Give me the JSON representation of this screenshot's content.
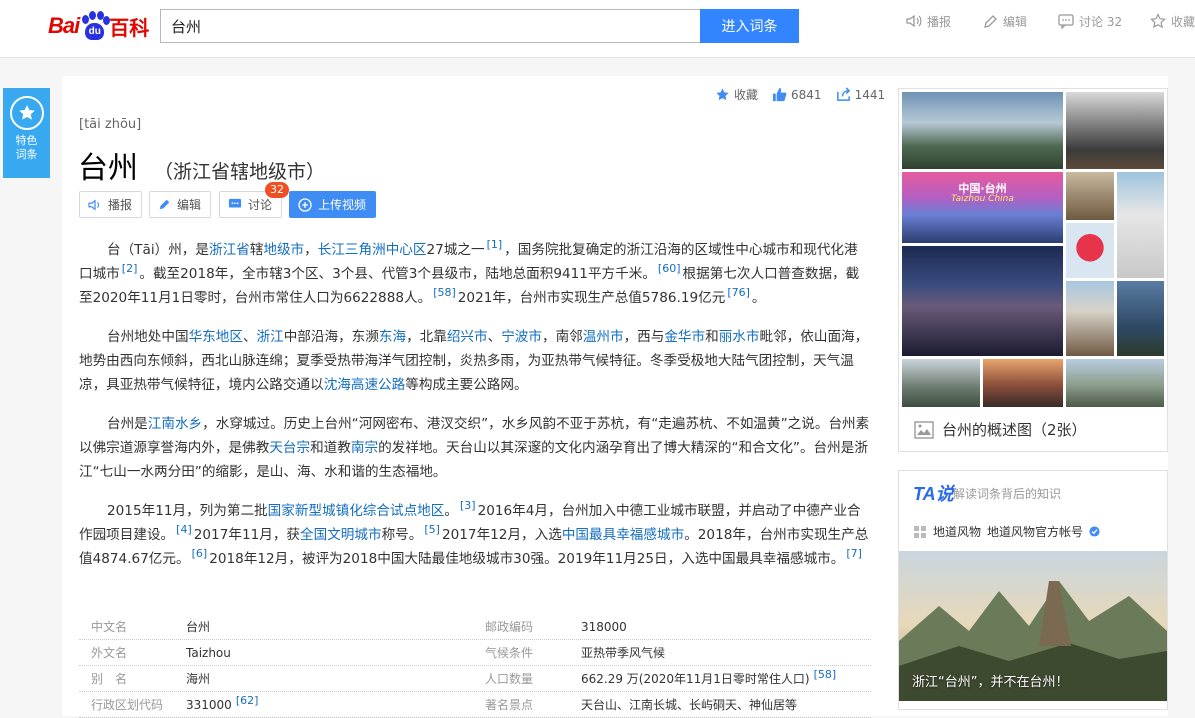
{
  "header": {
    "logo_bai": "Bai",
    "logo_du": "du",
    "logo_baike": "百科",
    "search_value": "台州",
    "search_button": "进入词条",
    "tools": [
      {
        "label": "播报",
        "icon": "speaker-icon"
      },
      {
        "label": "编辑",
        "icon": "pencil-icon"
      },
      {
        "label": "讨论 32",
        "icon": "chat-icon"
      },
      {
        "label": "收藏",
        "icon": "star-icon"
      }
    ]
  },
  "side_tab": {
    "line1": "特色",
    "line2": "词条"
  },
  "stats": {
    "favorite": "收藏",
    "likes": "6841",
    "shares": "1441"
  },
  "entry": {
    "pinyin": "[tāi zhōu]",
    "title": "台州",
    "subtitle": "（浙江省辖地级市）",
    "actions": {
      "broadcast": "播报",
      "edit": "编辑",
      "discuss": "讨论",
      "discuss_count": "32",
      "upload_video": "上传视频"
    }
  },
  "paragraphs": {
    "p1": {
      "t1": "台（Tāi）州，是",
      "l1": "浙江省",
      "t2": "辖",
      "l2": "地级市",
      "t3": "，",
      "l3": "长江三角洲中心区",
      "t4": "27城之一",
      "r1": "[1]",
      "t5": "，国务院批复确定的浙江沿海的区域性中心城市和现代化港口城市",
      "r2": "[2]",
      "t6": "。截至2018年，全市辖3个区、3个县、代管3个县级市，陆地总面积9411平方千米。",
      "r3": "[60]",
      "t7": "根据第七次人口普查数据，截至2020年11月1日零时，台州市常住人口为6622888人。",
      "r4": "[58]",
      "t8": "2021年，台州市实现生产总值5786.19亿元",
      "r5": "[76]",
      "t9": "。"
    },
    "p2": {
      "t1": "台州地处中国",
      "l1": "华东地区",
      "t2": "、",
      "l2": "浙江",
      "t3": "中部沿海，东濒",
      "l3": "东海",
      "t4": "，北靠",
      "l4": "绍兴市",
      "t5": "、",
      "l5": "宁波市",
      "t6": "，南邻",
      "l6": "温州市",
      "t7": "，西与",
      "l7": "金华市",
      "t8": "和",
      "l8": "丽水市",
      "t9": "毗邻，依山面海，地势由西向东倾斜，西北山脉连绵；夏季受热带海洋气团控制，炎热多雨，为亚热带气候特征。冬季受极地大陆气团控制，天气温凉，具亚热带气候特征，境内公路交通以",
      "l9": "沈海高速公路",
      "t10": "等构成主要公路网。"
    },
    "p3": {
      "t1": "台州是",
      "l1": "江南水乡",
      "t2": "，水穿城过。历史上台州“河网密布、港汊交织”，水乡风韵不亚于苏杭，有“走遍苏杭、不如温黄”之说。台州素以佛宗道源享誉海内外，是佛教",
      "l2": "天台宗",
      "t3": "和道教",
      "l3": "南宗",
      "t4": "的发祥地。天台山以其深邃的文化内涵孕育出了博大精深的“和合文化”。台州是浙江“七山一水两分田”的缩影，是山、海、水和谐的生态福地。"
    },
    "p4": {
      "t1": "2015年11月，列为第二批",
      "l1": "国家新型城镇化综合试点地区",
      "t2": "。",
      "r1": "[3]",
      "t3": "2016年4月，台州加入中德工业城市联盟，并启动了中德产业合作园项目建设。",
      "r2": "[4]",
      "t4": "2017年11月，获",
      "l2": "全国文明城市",
      "t5": "称号。",
      "r3": "[5]",
      "t6": "2017年12月，入选",
      "l3": "中国最具幸福感城市",
      "t7": "。2018年，台州市实现生产总值4874.67亿元。",
      "r4": "[6]",
      "t8": "2018年12月，被评为2018中国大陆最佳地级城市30强。2019年11月25日，入选中国最具幸福感城市。",
      "r5": "[7]"
    }
  },
  "infobox": {
    "rows": [
      {
        "k1": "中文名",
        "v1": "台州",
        "k2": "邮政编码",
        "v2": "318000"
      },
      {
        "k1": "外文名",
        "v1": "Taizhou",
        "k2": "气候条件",
        "v2": "亚热带季风气候"
      },
      {
        "k1": "别　名",
        "v1": "海州",
        "k2": "人口数量",
        "v2": "662.29 万(2020年11月1日零时常住人口)",
        "ref2": "[58]"
      },
      {
        "k1": "行政区划代码",
        "v1": "331000",
        "ref1": "[62]",
        "k2": "著名景点",
        "v2": "天台山、江南长城、长屿硐天、神仙居等"
      }
    ]
  },
  "album": {
    "caption": "台州的概述图（2张）",
    "banner_text": "中国·台州",
    "banner_sub": "Taizhou China"
  },
  "ta_card": {
    "logo": "TA说",
    "slogan": "解读词条背后的知识",
    "author": "地道风物",
    "author_account": "地道风物官方帐号",
    "caption": "浙江“台州”，并不在台州！"
  },
  "colors": {
    "link": "#136ec2",
    "accent": "#3385ff",
    "brand_red": "#e10601",
    "badge": "#f04f24"
  }
}
